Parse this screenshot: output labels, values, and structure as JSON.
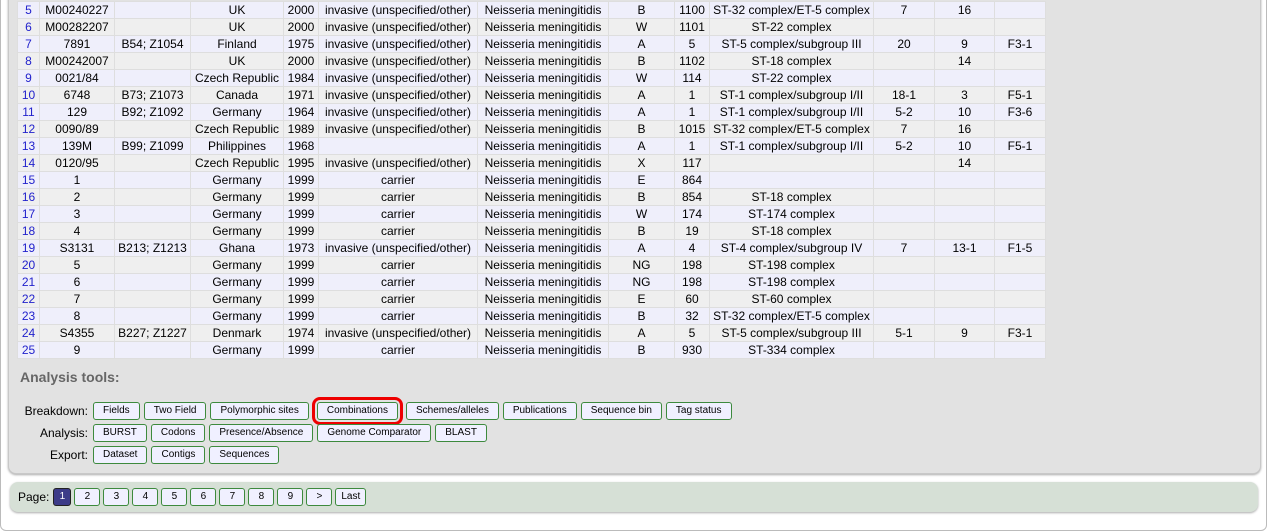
{
  "rows": [
    [
      "5",
      "M00240227",
      "",
      "UK",
      "2000",
      "invasive (unspecified/other)",
      "Neisseria meningitidis",
      "B",
      "1100",
      "ST-32 complex/ET-5 complex",
      "7",
      "16",
      ""
    ],
    [
      "6",
      "M00282207",
      "",
      "UK",
      "2000",
      "invasive (unspecified/other)",
      "Neisseria meningitidis",
      "W",
      "1101",
      "ST-22 complex",
      "",
      "",
      ""
    ],
    [
      "7",
      "7891",
      "B54; Z1054",
      "Finland",
      "1975",
      "invasive (unspecified/other)",
      "Neisseria meningitidis",
      "A",
      "5",
      "ST-5 complex/subgroup III",
      "20",
      "9",
      "F3-1"
    ],
    [
      "8",
      "M00242007",
      "",
      "UK",
      "2000",
      "invasive (unspecified/other)",
      "Neisseria meningitidis",
      "B",
      "1102",
      "ST-18 complex",
      "",
      "14",
      ""
    ],
    [
      "9",
      "0021/84",
      "",
      "Czech Republic",
      "1984",
      "invasive (unspecified/other)",
      "Neisseria meningitidis",
      "W",
      "114",
      "ST-22 complex",
      "",
      "",
      ""
    ],
    [
      "10",
      "6748",
      "B73; Z1073",
      "Canada",
      "1971",
      "invasive (unspecified/other)",
      "Neisseria meningitidis",
      "A",
      "1",
      "ST-1 complex/subgroup I/II",
      "18-1",
      "3",
      "F5-1"
    ],
    [
      "11",
      "129",
      "B92; Z1092",
      "Germany",
      "1964",
      "invasive (unspecified/other)",
      "Neisseria meningitidis",
      "A",
      "1",
      "ST-1 complex/subgroup I/II",
      "5-2",
      "10",
      "F3-6"
    ],
    [
      "12",
      "0090/89",
      "",
      "Czech Republic",
      "1989",
      "invasive (unspecified/other)",
      "Neisseria meningitidis",
      "B",
      "1015",
      "ST-32 complex/ET-5 complex",
      "7",
      "16",
      ""
    ],
    [
      "13",
      "139M",
      "B99; Z1099",
      "Philippines",
      "1968",
      "",
      "Neisseria meningitidis",
      "A",
      "1",
      "ST-1 complex/subgroup I/II",
      "5-2",
      "10",
      "F5-1"
    ],
    [
      "14",
      "0120/95",
      "",
      "Czech Republic",
      "1995",
      "invasive (unspecified/other)",
      "Neisseria meningitidis",
      "X",
      "117",
      "",
      "",
      "14",
      ""
    ],
    [
      "15",
      "1",
      "",
      "Germany",
      "1999",
      "carrier",
      "Neisseria meningitidis",
      "E",
      "864",
      "",
      "",
      "",
      ""
    ],
    [
      "16",
      "2",
      "",
      "Germany",
      "1999",
      "carrier",
      "Neisseria meningitidis",
      "B",
      "854",
      "ST-18 complex",
      "",
      "",
      ""
    ],
    [
      "17",
      "3",
      "",
      "Germany",
      "1999",
      "carrier",
      "Neisseria meningitidis",
      "W",
      "174",
      "ST-174 complex",
      "",
      "",
      ""
    ],
    [
      "18",
      "4",
      "",
      "Germany",
      "1999",
      "carrier",
      "Neisseria meningitidis",
      "B",
      "19",
      "ST-18 complex",
      "",
      "",
      ""
    ],
    [
      "19",
      "S3131",
      "B213; Z1213",
      "Ghana",
      "1973",
      "invasive (unspecified/other)",
      "Neisseria meningitidis",
      "A",
      "4",
      "ST-4 complex/subgroup IV",
      "7",
      "13-1",
      "F1-5"
    ],
    [
      "20",
      "5",
      "",
      "Germany",
      "1999",
      "carrier",
      "Neisseria meningitidis",
      "NG",
      "198",
      "ST-198 complex",
      "",
      "",
      ""
    ],
    [
      "21",
      "6",
      "",
      "Germany",
      "1999",
      "carrier",
      "Neisseria meningitidis",
      "NG",
      "198",
      "ST-198 complex",
      "",
      "",
      ""
    ],
    [
      "22",
      "7",
      "",
      "Germany",
      "1999",
      "carrier",
      "Neisseria meningitidis",
      "E",
      "60",
      "ST-60 complex",
      "",
      "",
      ""
    ],
    [
      "23",
      "8",
      "",
      "Germany",
      "1999",
      "carrier",
      "Neisseria meningitidis",
      "B",
      "32",
      "ST-32 complex/ET-5 complex",
      "",
      "",
      ""
    ],
    [
      "24",
      "S4355",
      "B227; Z1227",
      "Denmark",
      "1974",
      "invasive (unspecified/other)",
      "Neisseria meningitidis",
      "A",
      "5",
      "ST-5 complex/subgroup III",
      "5-1",
      "9",
      "F3-1"
    ],
    [
      "25",
      "9",
      "",
      "Germany",
      "1999",
      "carrier",
      "Neisseria meningitidis",
      "B",
      "930",
      "ST-334 complex",
      "",
      "",
      ""
    ]
  ],
  "analysis": {
    "title": "Analysis tools:",
    "groups": [
      {
        "label": "Breakdown:",
        "buttons": [
          "Fields",
          "Two Field",
          "Polymorphic sites",
          "Combinations",
          "Schemes/alleles",
          "Publications",
          "Sequence bin",
          "Tag status"
        ],
        "highlighted": "Combinations"
      },
      {
        "label": "Analysis:",
        "buttons": [
          "BURST",
          "Codons",
          "Presence/Absence",
          "Genome Comparator",
          "BLAST"
        ]
      },
      {
        "label": "Export:",
        "buttons": [
          "Dataset",
          "Contigs",
          "Sequences"
        ]
      }
    ]
  },
  "pager": {
    "label": "Page:",
    "current": "1",
    "pages": [
      "1",
      "2",
      "3",
      "4",
      "5",
      "6",
      "7",
      "8",
      "9",
      ">",
      "Last"
    ]
  },
  "colors": {
    "highlight": "#ee0000",
    "current_page": "#3c3c88"
  }
}
